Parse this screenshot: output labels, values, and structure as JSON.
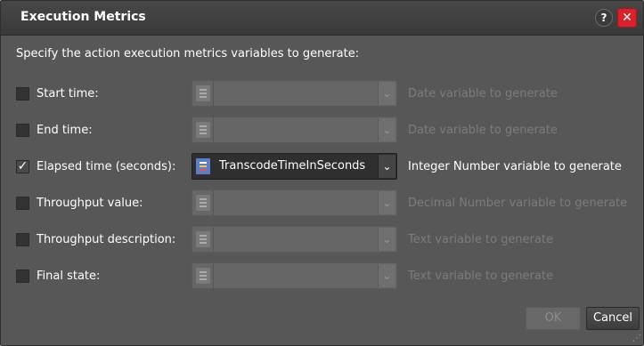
{
  "dialog": {
    "title": "Execution Metrics",
    "help_symbol": "?",
    "close_symbol": "✕",
    "instruction": "Specify the action execution metrics variables to generate:"
  },
  "rows": [
    {
      "label": "Start time:",
      "checked": false,
      "value": "",
      "hint": "Date variable to generate",
      "enabled": false
    },
    {
      "label": "End time:",
      "checked": false,
      "value": "",
      "hint": "Date variable to generate",
      "enabled": false
    },
    {
      "label": "Elapsed time (seconds):",
      "checked": true,
      "value": "TranscodeTimeInSeconds",
      "hint": "Integer Number variable to generate",
      "enabled": true
    },
    {
      "label": "Throughput value:",
      "checked": false,
      "value": "",
      "hint": "Decimal Number variable to generate",
      "enabled": false
    },
    {
      "label": "Throughput description:",
      "checked": false,
      "value": "",
      "hint": "Text variable to generate",
      "enabled": false
    },
    {
      "label": "Final state:",
      "checked": false,
      "value": "",
      "hint": "Text variable to generate",
      "enabled": false
    }
  ],
  "check_mark": "✓",
  "dropdown_arrow": "⌄",
  "buttons": {
    "ok": "OK",
    "cancel": "Cancel"
  },
  "icons": {
    "help": "help-icon",
    "close": "close-icon",
    "variable": "variable-list-icon",
    "dropdown": "chevron-down-icon"
  },
  "colors": {
    "dialog_bg": "#575757",
    "close_red": "#d8222a",
    "variable_icon_blue": "#5b7fc7",
    "disabled_text": "#7c7c7c"
  }
}
